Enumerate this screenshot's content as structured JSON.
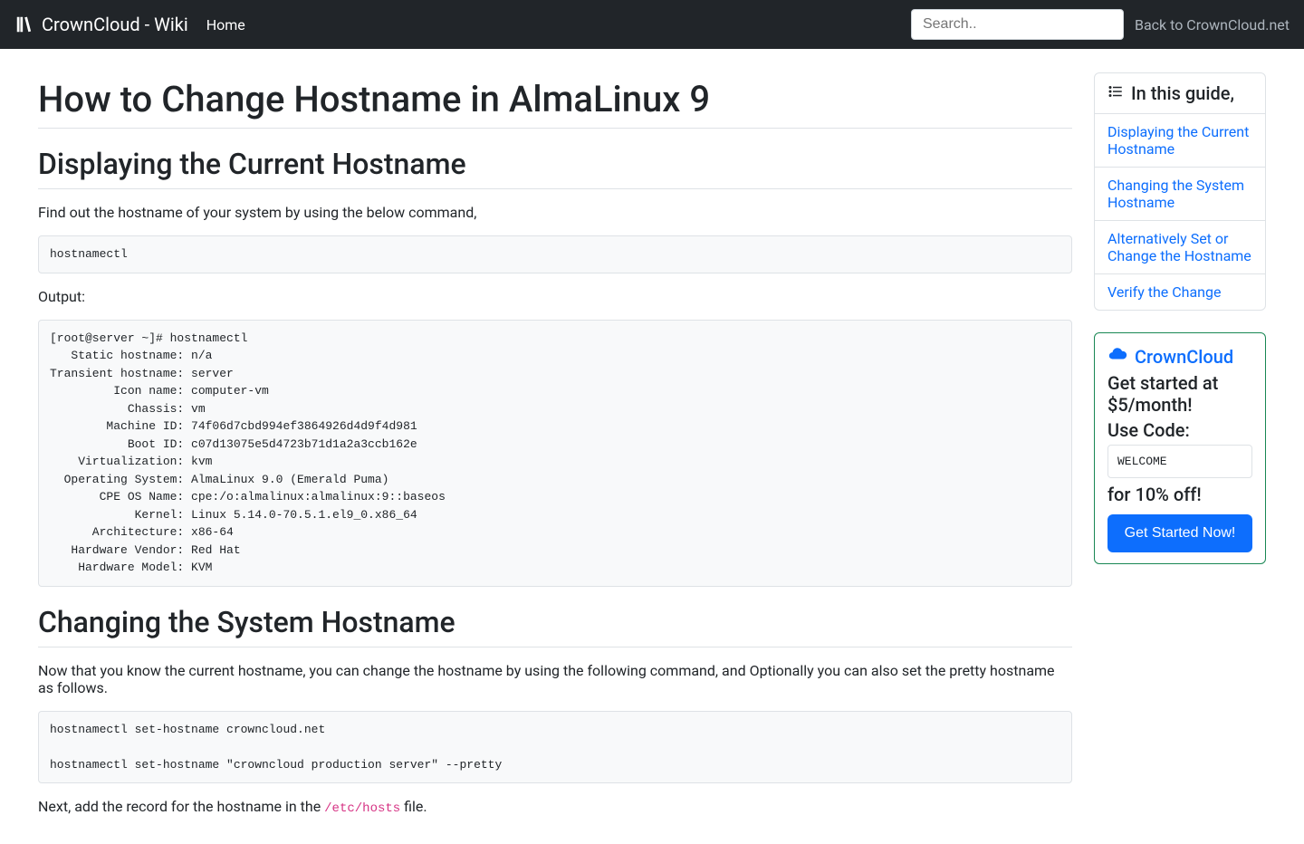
{
  "nav": {
    "brand": "CrownCloud - Wiki",
    "home": "Home",
    "search_placeholder": "Search..",
    "back": "Back to CrownCloud.net"
  },
  "page": {
    "title": "How to Change Hostname in AlmaLinux 9",
    "sections": {
      "s1_heading": "Displaying the Current Hostname",
      "s1_p1": "Find out the hostname of your system by using the below command,",
      "s1_code1": "hostnamectl",
      "s1_output_label": "Output:",
      "s1_code2": "[root@server ~]# hostnamectl\n   Static hostname: n/a\nTransient hostname: server\n         Icon name: computer-vm\n           Chassis: vm\n        Machine ID: 74f06d7cbd994ef3864926d4d9f4d981\n           Boot ID: c07d13075e5d4723b71d1a2a3ccb162e\n    Virtualization: kvm\n  Operating System: AlmaLinux 9.0 (Emerald Puma)\n       CPE OS Name: cpe:/o:almalinux:almalinux:9::baseos\n            Kernel: Linux 5.14.0-70.5.1.el9_0.x86_64\n      Architecture: x86-64\n   Hardware Vendor: Red Hat\n    Hardware Model: KVM",
      "s2_heading": "Changing the System Hostname",
      "s2_p1": "Now that you know the current hostname, you can change the hostname by using the following command, and Optionally you can also set the pretty hostname as follows.",
      "s2_code1": "hostnamectl set-hostname crowncloud.net\n\nhostnamectl set-hostname \"crowncloud production server\" --pretty",
      "s2_p2_pre": "Next, add the record for the hostname in the ",
      "s2_p2_code": "/etc/hosts",
      "s2_p2_post": " file."
    }
  },
  "toc": {
    "header": "In this guide,",
    "items": [
      "Displaying the Current Hostname",
      "Changing the System Hostname",
      "Alternatively Set or Change the Hostname",
      "Verify the Change"
    ]
  },
  "promo": {
    "title": "CrownCloud",
    "sub": "Get started at $5/month!",
    "label": "Use Code:",
    "code": "WELCOME",
    "off": "for 10% off!",
    "button": "Get Started Now!"
  }
}
